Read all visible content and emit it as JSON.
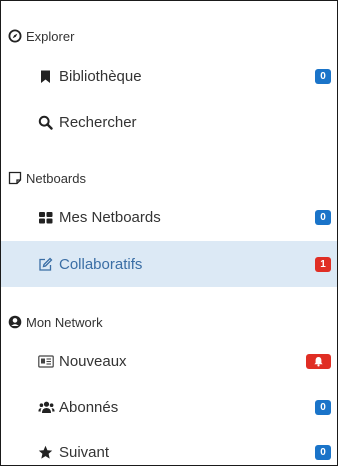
{
  "sidebar": {
    "sections": [
      {
        "label": "Explorer",
        "icon": "compass-icon",
        "items": [
          {
            "label": "Bibliothèque",
            "icon": "bookmark-icon",
            "badge": "0",
            "badge_color": "#1a74c9"
          },
          {
            "label": "Rechercher",
            "icon": "search-icon",
            "badge": null
          }
        ]
      },
      {
        "label": "Netboards",
        "icon": "note-icon",
        "items": [
          {
            "label": "Mes Netboards",
            "icon": "grid-icon",
            "badge": "0",
            "badge_color": "#1a74c9"
          },
          {
            "label": "Collaboratifs",
            "icon": "edit-icon",
            "badge": "1",
            "badge_color": "#e02e24",
            "active": true
          }
        ]
      },
      {
        "label": "Mon Network",
        "icon": "user-circle-icon",
        "items": [
          {
            "label": "Nouveaux",
            "icon": "id-card-icon",
            "badge_icon": "bell-icon",
            "badge_color": "#e02e24"
          },
          {
            "label": "Abonnés",
            "icon": "users-icon",
            "badge": "0",
            "badge_color": "#1a74c9"
          },
          {
            "label": "Suivant",
            "icon": "star-icon",
            "badge": "0",
            "badge_color": "#1a74c9"
          }
        ]
      }
    ],
    "active_color": "#dce9f5"
  }
}
